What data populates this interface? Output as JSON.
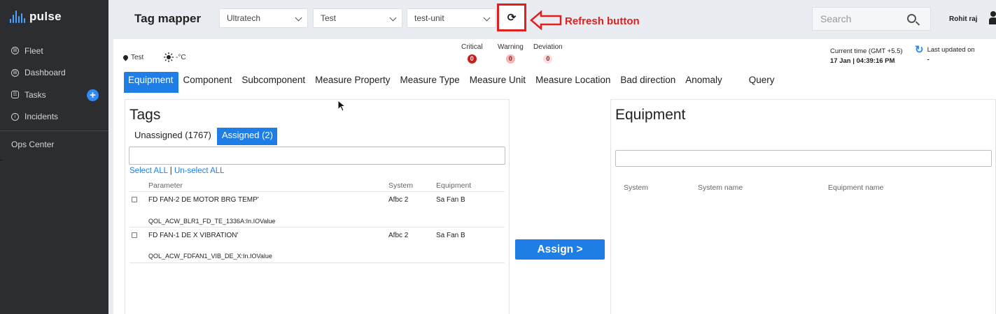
{
  "app": {
    "name": "pulse"
  },
  "sidebar": {
    "items": [
      {
        "label": "Fleet",
        "icon": "fleet-icon"
      },
      {
        "label": "Dashboard",
        "icon": "dashboard-icon"
      },
      {
        "label": "Tasks",
        "icon": "tasks-icon"
      },
      {
        "label": "Incidents",
        "icon": "info-icon"
      }
    ],
    "tasks_add": "+",
    "ops_center": "Ops Center"
  },
  "header": {
    "title": "Tag mapper",
    "select_org": "Ultratech",
    "select_site": "Test",
    "select_unit": "test-unit",
    "refresh_glyph": "⟳",
    "annotation": "Refresh button",
    "search_placeholder": "Search",
    "user_name": "Rohit raj"
  },
  "status": {
    "location": "Test",
    "temperature": "-°C",
    "critical_label": "Critical",
    "critical_count": "0",
    "warning_label": "Warning",
    "warning_count": "0",
    "deviation_label": "Deviation",
    "deviation_count": "0",
    "current_time_label": "Current time (GMT +5.5)",
    "current_time": "17 Jan | 04:39:16 PM",
    "last_updated_label": "Last updated on",
    "last_updated_value": "-"
  },
  "tabs": [
    "Equipment",
    "Component",
    "Subcomponent",
    "Measure Property",
    "Measure Type",
    "Measure Unit",
    "Measure Location",
    "Bad direction",
    "Anomaly",
    "Query"
  ],
  "tags": {
    "title": "Tags",
    "unassigned_label": "Unassigned (1767)",
    "assigned_label": "Assigned (2)",
    "select_all": "Select ALL",
    "separator": "|",
    "unselect_all": "Un-select ALL",
    "columns": {
      "parameter": "Parameter",
      "system": "System",
      "equipment": "Equipment"
    },
    "rows": [
      {
        "parameter": "FD FAN-2 DE MOTOR BRG TEMP'",
        "tag": "QOL_ACW_BLR1_FD_TE_1336A:In.IOValue",
        "system": "Afbc 2",
        "equipment": "Sa Fan B"
      },
      {
        "parameter": "FD FAN-1 DE X VIBRATION'",
        "tag": "QOL_ACW_FDFAN1_VIB_DE_X:In.IOValue",
        "system": "Afbc 2",
        "equipment": "Sa Fan B"
      }
    ]
  },
  "assign_button": "Assign >",
  "equipment": {
    "title": "Equipment",
    "columns": {
      "system": "System",
      "system_name": "System name",
      "equipment_name": "Equipment name"
    }
  },
  "colors": {
    "accent": "#1f7de6",
    "annotation": "#e02020",
    "sidebar": "#2b2d31"
  }
}
